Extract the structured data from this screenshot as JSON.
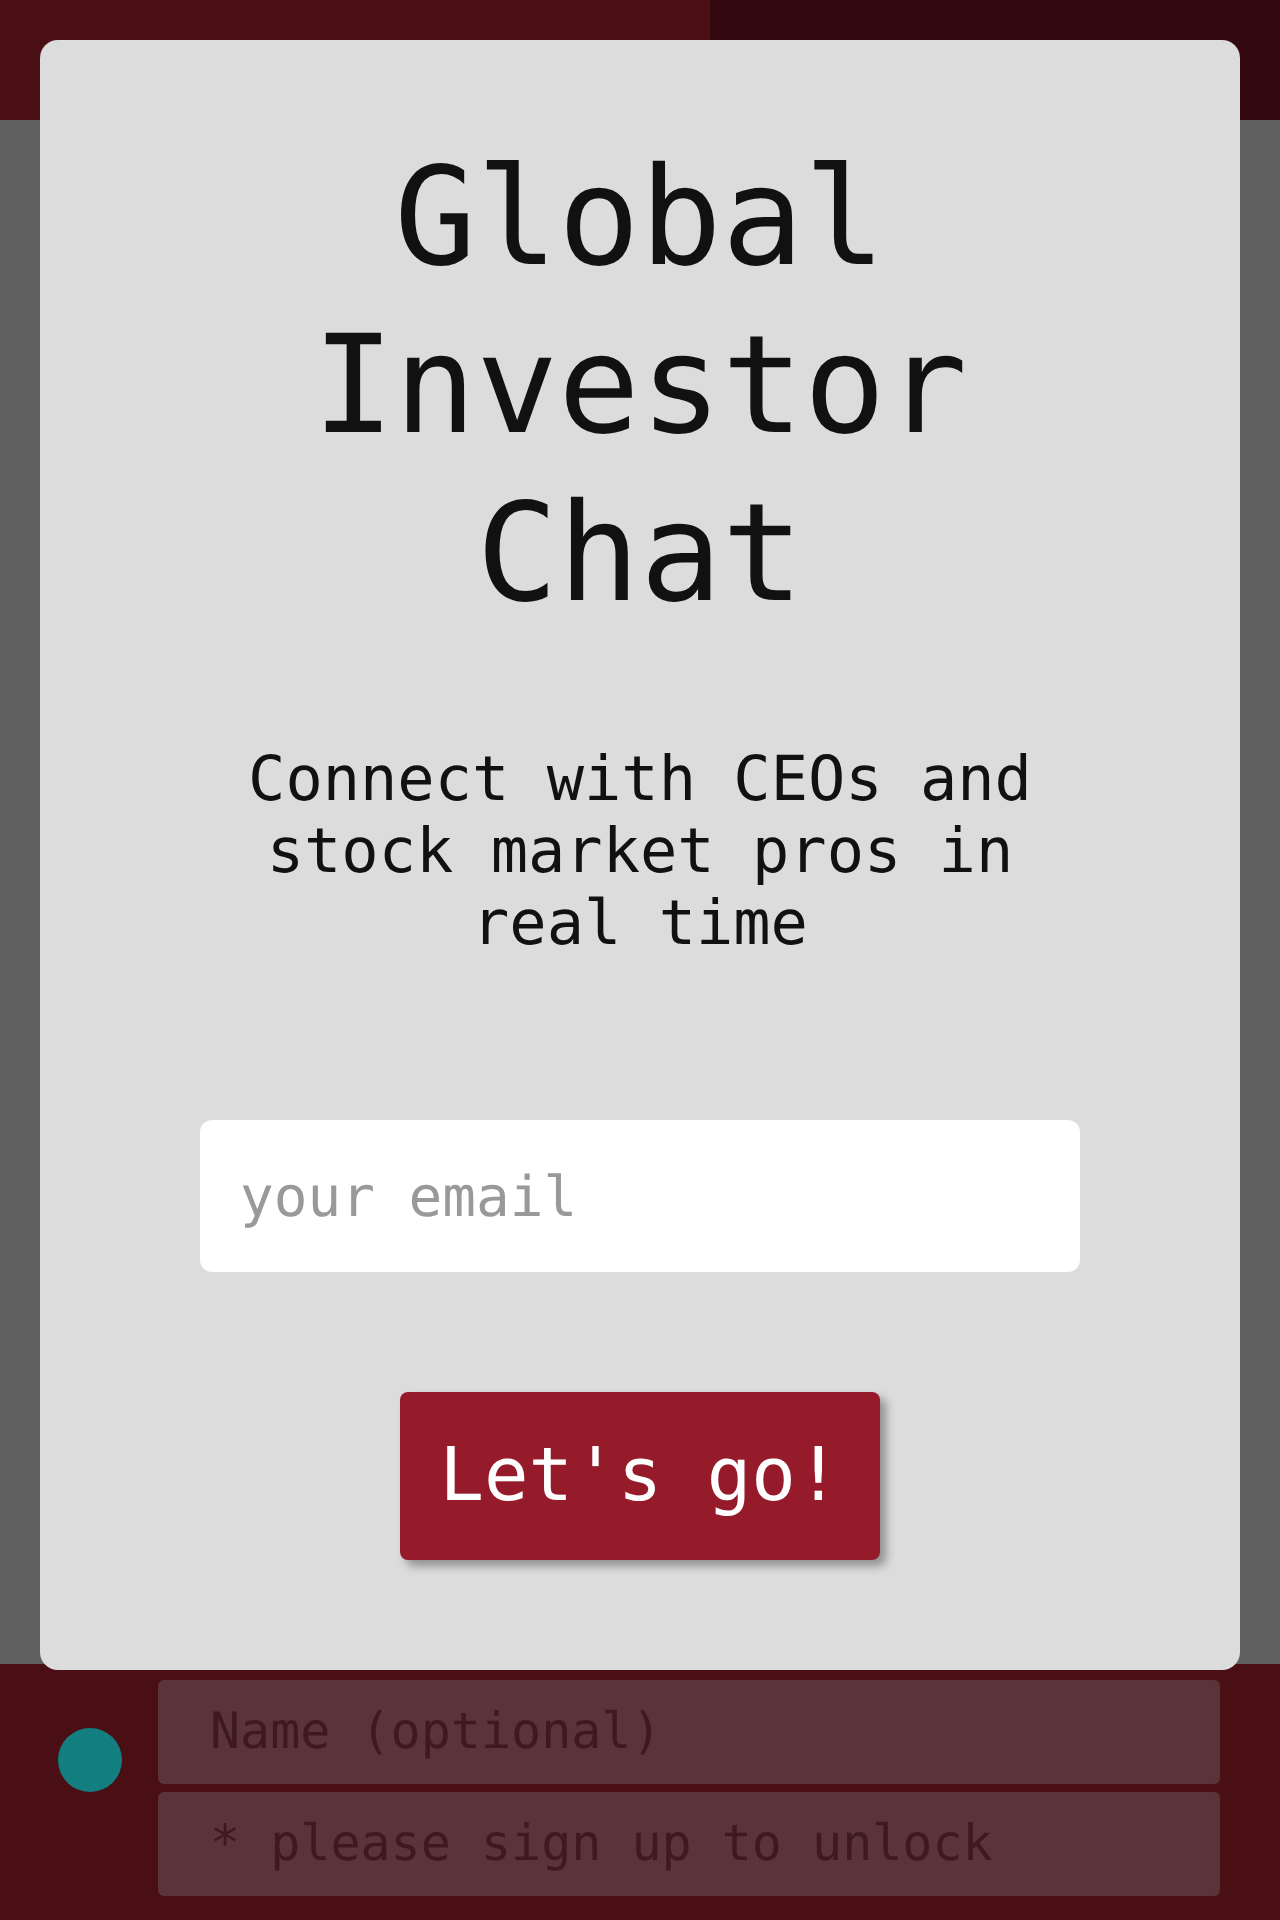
{
  "composer": {
    "name_placeholder": "Name (optional)",
    "message_placeholder": "* please sign up to unlock",
    "avatar": {
      "color": "#127e80"
    }
  },
  "modal": {
    "title": "Global Investor Chat",
    "subtitle": "Connect with CEOs and stock market pros in real time",
    "email_placeholder": "your email",
    "button": "Let's go!"
  }
}
